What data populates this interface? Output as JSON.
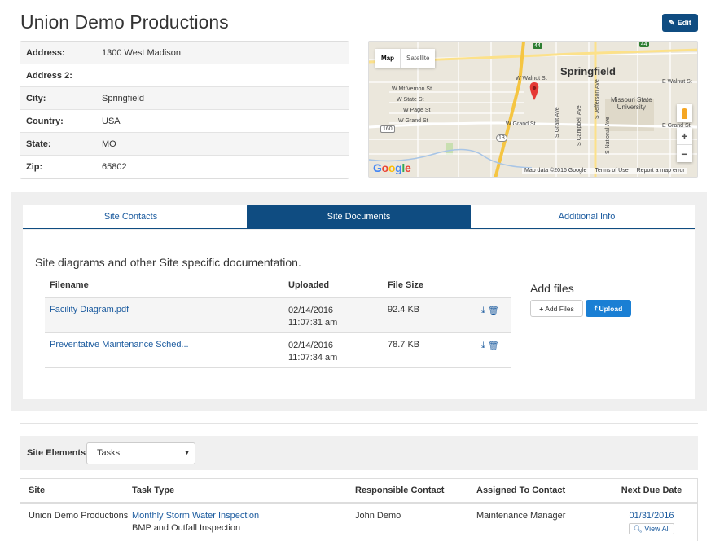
{
  "header": {
    "title": "Union Demo Productions",
    "edit_label": "Edit"
  },
  "address": [
    {
      "key": "Address:",
      "value": "1300 West Madison"
    },
    {
      "key": "Address 2:",
      "value": ""
    },
    {
      "key": "City:",
      "value": "Springfield"
    },
    {
      "key": "Country:",
      "value": "USA"
    },
    {
      "key": "State:",
      "value": "MO"
    },
    {
      "key": "Zip:",
      "value": "65802"
    }
  ],
  "map": {
    "type_map": "Map",
    "type_satellite": "Satellite",
    "city": "Springfield",
    "university": "Missouri State\nUniversity",
    "streets": {
      "walnut": "W Walnut St",
      "mt_vernon": "W Mt Vernon St",
      "state": "W State St",
      "page": "W Page St",
      "grand": "W Grand St",
      "grand2": "W Grand St",
      "e_walnut": "E Walnut St",
      "e_grand": "E Grand St",
      "grant": "S Grant Ave",
      "campbell": "S Campbell Ave",
      "jefferson": "S Jefferson Ave",
      "national": "S National Ave",
      "route160": "160",
      "route13": "13",
      "route44a": "44",
      "route44b": "44"
    },
    "google": "Google",
    "attribution": "Map data ©2016 Google",
    "terms": "Terms of Use",
    "report": "Report a map error",
    "zoom_in": "+",
    "zoom_out": "−"
  },
  "tabs": [
    {
      "label": "Site Contacts"
    },
    {
      "label": "Site Documents"
    },
    {
      "label": "Additional Info"
    }
  ],
  "documents": {
    "description": "Site diagrams and other Site specific documentation.",
    "columns": {
      "filename": "Filename",
      "uploaded": "Uploaded",
      "size": "File Size"
    },
    "files": [
      {
        "name": "Facility Diagram.pdf",
        "date": "02/14/2016",
        "time": "11:07:31 am",
        "size": "92.4 KB"
      },
      {
        "name": "Preventative Maintenance Sched...",
        "date": "02/14/2016",
        "time": "11:07:34 am",
        "size": "78.7 KB"
      }
    ],
    "add_files_title": "Add files",
    "add_files_button": "Add Files",
    "upload_button": "Upload"
  },
  "site_elements": {
    "label": "Site Elements:",
    "selected": "Tasks"
  },
  "tasks": {
    "columns": {
      "site": "Site",
      "type": "Task Type",
      "responsible": "Responsible Contact",
      "assigned": "Assigned To Contact",
      "due": "Next Due Date"
    },
    "rows": [
      {
        "site": "Union Demo Productions",
        "type": "Monthly Storm Water Inspection",
        "subtype": "BMP and Outfall Inspection",
        "responsible": "John Demo",
        "assigned": "Maintenance Manager",
        "due": "01/31/2016",
        "view_all": "View All"
      }
    ]
  }
}
